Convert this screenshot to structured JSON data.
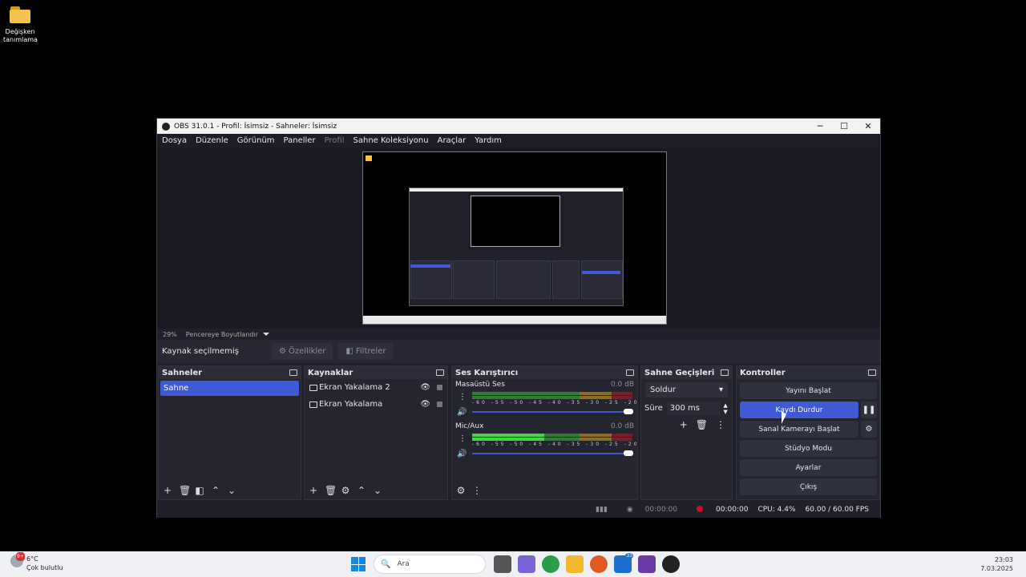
{
  "desktop": {
    "icon_label": "Değişken tanımlama"
  },
  "window": {
    "title": "OBS 31.0.1 - Profil: İsimsiz - Sahneler: İsimsiz",
    "controls": {
      "minimize": "─",
      "maximize": "☐",
      "close": "✕"
    }
  },
  "menu": [
    "Dosya",
    "Düzenle",
    "Görünüm",
    "Paneller",
    "Profil",
    "Sahne Koleksiyonu",
    "Araçlar",
    "Yardım"
  ],
  "preview": {
    "zoom": "29%",
    "scale_mode": "Pencereye Boyutlandır"
  },
  "source_toolbar": {
    "no_source": "Kaynak seçilmemiş",
    "properties": "Özellikler",
    "filters": "Filtreler"
  },
  "scenes": {
    "title": "Sahneler",
    "items": [
      "Sahne"
    ]
  },
  "sources": {
    "title": "Kaynaklar",
    "items": [
      "Ekran Yakalama 2",
      "Ekran Yakalama"
    ]
  },
  "mixer": {
    "title": "Ses Karıştırıcı",
    "ticks": "-60 -55 -50 -45 -40 -35 -30 -25 -20 -15 -10 -5 0",
    "channels": [
      {
        "name": "Masaüstü Ses",
        "db": "0.0 dB",
        "volume": 1.0
      },
      {
        "name": "Mic/Aux",
        "db": "0.0 dB",
        "volume": 1.0
      }
    ]
  },
  "transitions": {
    "title": "Sahne Geçişleri",
    "selected": "Soldur",
    "duration_label": "Süre",
    "duration": "300 ms"
  },
  "controls": {
    "title": "Kontroller",
    "start_stream": "Yayını Başlat",
    "stop_record": "Kaydı Durdur",
    "virtual_cam": "Sanal Kamerayı Başlat",
    "studio_mode": "Stüdyo Modu",
    "settings": "Ayarlar",
    "exit": "Çıkış"
  },
  "status": {
    "stream_time": "00:00:00",
    "rec_time": "00:00:00",
    "cpu": "CPU: 4.4%",
    "fps": "60.00 / 60.00 FPS"
  },
  "taskbar": {
    "weather_temp": "6°C",
    "weather_desc": "Çok bulutlu",
    "weather_badge": "9+",
    "search_placeholder": "Ara",
    "badge_count": "33",
    "time": "23:03",
    "date": "7.03.2025"
  },
  "colors": {
    "accent": "#4059d6",
    "record": "#c8102e"
  }
}
